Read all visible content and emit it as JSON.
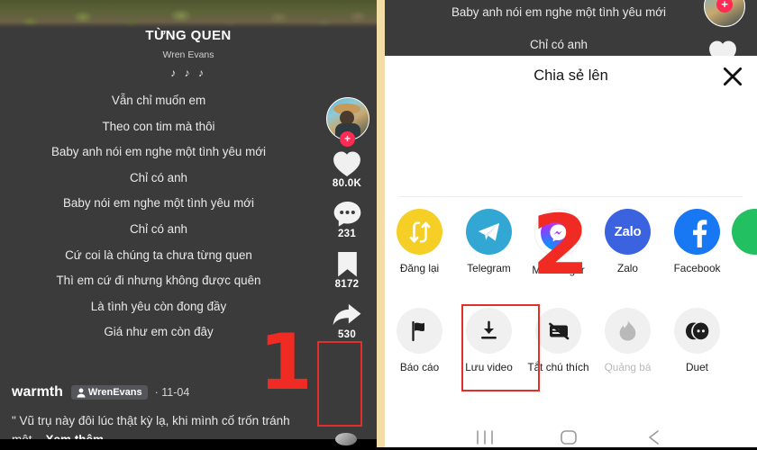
{
  "left_panel": {
    "music": {
      "title": "TỪNG QUEN",
      "artist": "Wren Evans",
      "notes": "♪ ♪ ♪"
    },
    "lyrics": [
      "Vẫn chỉ muốn em",
      "Theo con tim mà thôi",
      "Baby anh nói em nghe một tình yêu mới",
      "Chỉ có anh",
      "Baby nói em nghe một tình yêu mới",
      "Chỉ có anh",
      "Cứ coi là chúng ta chưa từng quen",
      "Thì em cứ đi nhưng không được quên",
      "Là tình yêu còn đong đầy",
      "Giá như em còn đây"
    ],
    "rail": {
      "avatar_badge": "+",
      "like_count": "80.0K",
      "comment_count": "231",
      "bookmark_count": "8172",
      "share_count": "530"
    },
    "meta": {
      "username": "warmth",
      "music_chip": "WrenEvans",
      "separator": "·",
      "date": "11-04"
    },
    "caption": {
      "text": "\" Vũ trụ này đôi lúc thật kỳ lạ, khi mình cố trốn tránh một...",
      "more_label": "Xem thêm"
    },
    "annotation": "1"
  },
  "right_panel": {
    "video_preview": {
      "lyric_top": "Baby anh nói em nghe một tình yêu mới",
      "lyric_bottom": "Chỉ có anh",
      "avatar_badge": "+"
    },
    "sheet": {
      "title": "Chia sẻ lên",
      "close_icon": "close-icon",
      "row_1": [
        {
          "label": "Đăng lại",
          "icon": "repost-icon",
          "color": "#F5CF26",
          "dim": false
        },
        {
          "label": "Telegram",
          "icon": "telegram-icon",
          "color": "#33A7D4",
          "dim": false
        },
        {
          "label": "Messenger",
          "icon": "messenger-icon",
          "color": "#A033FF",
          "dim": false
        },
        {
          "label": "Zalo",
          "icon": "zalo-icon",
          "color": "#3B63E0",
          "dim": false
        },
        {
          "label": "Facebook",
          "icon": "facebook-icon",
          "color": "#1877F2",
          "dim": false
        }
      ],
      "row_2": [
        {
          "label": "Báo cáo",
          "icon": "flag-icon",
          "color": "#F0F0F0",
          "dim": false
        },
        {
          "label": "Lưu video",
          "icon": "download-icon",
          "color": "#F0F0F0",
          "dim": false
        },
        {
          "label": "Tắt chú thích",
          "icon": "captions-off-icon",
          "color": "#F0F0F0",
          "dim": false
        },
        {
          "label": "Quảng bá",
          "icon": "flame-icon",
          "color": "#F0F0F0",
          "dim": true
        },
        {
          "label": "Duet",
          "icon": "duet-icon",
          "color": "#F0F0F0",
          "dim": false
        }
      ]
    },
    "annotation": "2",
    "navbar": {
      "recents": "recents-icon",
      "home": "home-icon",
      "back": "back-icon"
    }
  },
  "colors": {
    "annotation_red": "#EF2B23",
    "highlight_border": "#E1302A",
    "divider_tan": "#F2DDA7",
    "video_bg": "#3B3B3B",
    "tiktok_pink": "#FE2C55"
  }
}
